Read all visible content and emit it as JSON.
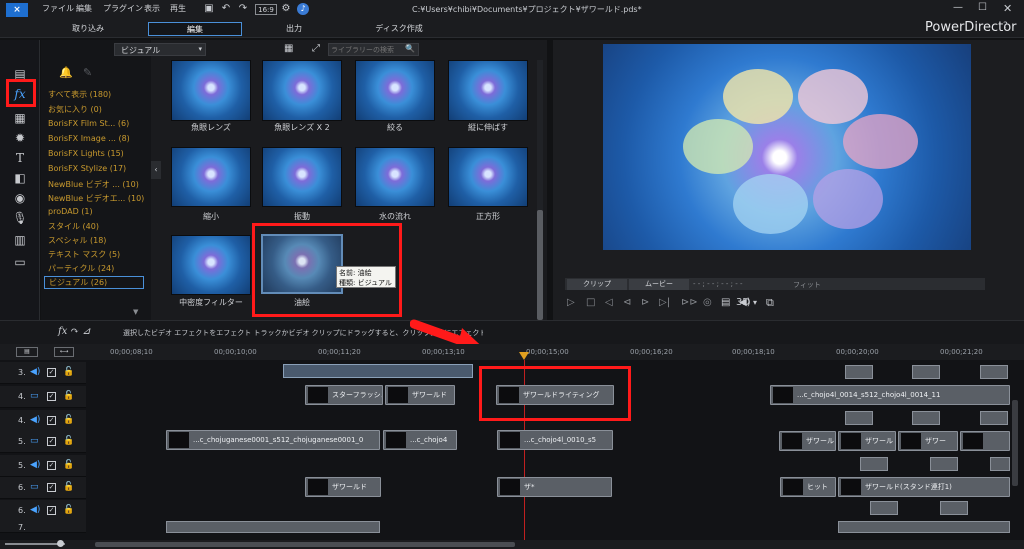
{
  "window": {
    "title": "C:¥Users¥chibi¥Documents¥プロジェクト¥ザワールド.pds*",
    "brand": "PowerDirector",
    "help": "?"
  },
  "menu": [
    "ファイル",
    "編集",
    "プラグイン",
    "表示",
    "再生"
  ],
  "toolbar": {
    "fit_label": "16:9"
  },
  "modes": [
    "取り込み",
    "編集",
    "出力",
    "ディスク作成"
  ],
  "library": {
    "category_dropdown": "ビジュアル",
    "search_placeholder": "ライブラリーの検索",
    "categories": [
      "すべて表示 (180)",
      "お気に入り (0)",
      "BorisFX Film St... (6)",
      "BorisFX Image ... (8)",
      "BorisFX Lights (15)",
      "BorisFX Stylize (17)",
      "NewBlue ビデオ ... (10)",
      "NewBlue ビデオエ... (10)",
      "proDAD (1)",
      "スタイル (40)",
      "スペシャル (18)",
      "テキスト マスク (5)",
      "パーティクル (24)",
      "ビジュアル (26)"
    ],
    "effects": [
      "魚眼レンズ",
      "魚眼レンズ X 2",
      "絞る",
      "縦に伸ばす",
      "縮小",
      "振動",
      "水の流れ",
      "正方形",
      "中密度フィルター",
      "油絵"
    ],
    "tooltip": {
      "name": "名前: 油絵",
      "type": "種類: ビジュアル"
    }
  },
  "preview": {
    "clip_tab": "クリップ",
    "movie_tab": "ムービー",
    "timecode": "- - ; - - ; - - ; - -",
    "fit": "フィット",
    "mode_3d": "3D"
  },
  "timeline": {
    "hint": "選択したビデオ エフェクトをエフェクト トラックかビデオ クリップにドラッグすると、クリップ全体にエフェクトが適用されます",
    "ruler": [
      "00;00;08;10",
      "00;00;10;00",
      "00;00;11;20",
      "00;00;13;10",
      "00;00;15;00",
      "00;00;16;20",
      "00;00;18;10",
      "00;00;20;00",
      "00;00;21;20"
    ],
    "tracks": [
      "3.",
      "4.",
      "4.",
      "5.",
      "5.",
      "6.",
      "6.",
      "7."
    ],
    "clips": {
      "c1": "スターフラッシュ",
      "c2": "ザワールド",
      "c3": "ザワールドライティング",
      "c4": "...c_chojo4l_0014_s512_chojo4l_0014_11",
      "c5": "...c_chojuganese0001_s512_chojuganese0001_0",
      "c6": "...c_chojo4",
      "c7": "...c_chojo4l_0010_s5",
      "c8": "ザワールド",
      "c9": "ザ*",
      "c10": "ヒット",
      "c11": "ザワールド(スタンド連打1)",
      "c12": "ザワール",
      "c13": "ザワール",
      "c14": "ザワー"
    }
  }
}
